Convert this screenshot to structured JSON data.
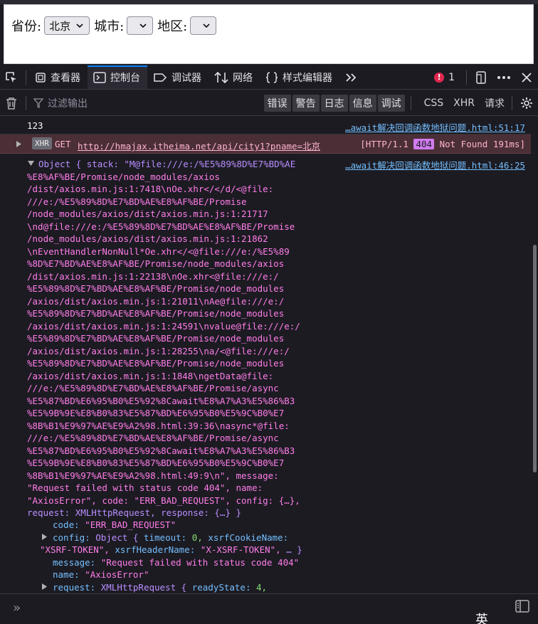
{
  "page": {
    "province_label": "省份:",
    "province_value": "北京",
    "city_label": "城市:",
    "city_value": "",
    "area_label": "地区:",
    "area_value": ""
  },
  "devtools": {
    "tabs": [
      {
        "label": "查看器",
        "icon": "inspector-icon"
      },
      {
        "label": "控制台",
        "icon": "console-icon",
        "active": true
      },
      {
        "label": "调试器",
        "icon": "debugger-icon"
      },
      {
        "label": "网络",
        "icon": "network-icon"
      },
      {
        "label": "样式编辑器",
        "icon": "style-editor-icon"
      }
    ],
    "error_count": "1",
    "filter_placeholder": "过滤输出",
    "levels": [
      "错误",
      "警告",
      "日志",
      "信息",
      "调试"
    ],
    "types": [
      "CSS",
      "XHR",
      "请求"
    ],
    "accent_color": "#0a84ff",
    "error_color": "#e22850"
  },
  "console": {
    "log1": {
      "text": "123",
      "source": "…await解决回调函数地狱问题.html:51:17"
    },
    "xhr": {
      "badge": "XHR",
      "method": "GET",
      "url": "http://hmajax.itheima.net/api/city1?pname=北京",
      "status_prefix": "[HTTP/1.1",
      "code": "404",
      "status_suffix": "Not Found 191ms]"
    },
    "object": {
      "source": "…await解决回调函数地狱问题.html:46:25",
      "lines": [
        "Object { stack: \"M@file:///e:/%E5%89%8D%E7%BD%AE",
        "%E8%AF%BE/Promise/node_modules/axios",
        "/dist/axios.min.js:1:7418\\nOe.xhr</</d/<@file:",
        "///e:/%E5%89%8D%E7%BD%AE%E8%AF%BE/Promise",
        "/node_modules/axios/dist/axios.min.js:1:21717",
        "\\nd@file:///e:/%E5%89%8D%E7%BD%AE%E8%AF%BE/Promise",
        "/node_modules/axios/dist/axios.min.js:1:21862",
        "\\nEventHandlerNonNull*Oe.xhr</<@file:///e:/%E5%89",
        "%8D%E7%BD%AE%E8%AF%BE/Promise/node_modules/axios",
        "/dist/axios.min.js:1:22138\\nOe.xhr<@file:///e:/",
        "%E5%89%8D%E7%BD%AE%E8%AF%BE/Promise/node_modules",
        "/axios/dist/axios.min.js:1:21011\\nAe@file:///e:/",
        "%E5%89%8D%E7%BD%AE%E8%AF%BE/Promise/node_modules",
        "/axios/dist/axios.min.js:1:24591\\nvalue@file:///e:/",
        "%E5%89%8D%E7%BD%AE%E8%AF%BE/Promise/node_modules",
        "/axios/dist/axios.min.js:1:28255\\na/<@file:///e:/",
        "%E5%89%8D%E7%BD%AE%E8%AF%BE/Promise/node_modules",
        "/axios/dist/axios.min.js:1:1848\\ngetData@file:",
        "///e:/%E5%89%8D%E7%BD%AE%E8%AF%BE/Promise/async",
        "%E5%87%BD%E6%95%B0%E5%92%8Cawait%E8%A7%A3%E5%86%B3",
        "%E5%9B%9E%E8%B0%83%E5%87%BD%E6%95%B0%E5%9C%B0%E7",
        "%8B%B1%E9%97%AE%E9%A2%98.html:39:36\\nasync*@file:",
        "///e:/%E5%89%8D%E7%BD%AE%E8%AF%BE/Promise/async",
        "%E5%87%BD%E6%95%B0%E5%92%8Cawait%E8%A7%A3%E5%86%B3",
        "%E5%9B%9E%E8%B0%83%E5%87%BD%E6%95%B0%E5%9C%B0%E7",
        "%8B%B1%E9%97%AE%E9%A2%98.html:49:9\\n\", message:",
        "\"Request failed with status code 404\", name:",
        "\"AxiosError\", code: \"ERR_BAD_REQUEST\", config: {…},",
        "request: XMLHttpRequest, response: {…} }"
      ],
      "props": {
        "code_key": "code:",
        "code_val": "\"ERR_BAD_REQUEST\"",
        "config_key": "config:",
        "config_type": "Object {",
        "config_k1": "timeout:",
        "config_v1": "0,",
        "config_k2": "xsrfCookieName:",
        "config_v2": "\"XSRF-TOKEN\",",
        "config_k3": "xsrfHeaderName:",
        "config_v3": "\"X-XSRF-TOKEN\",",
        "config_end": "… }",
        "message_key": "message:",
        "message_val": "\"Request failed with status code 404\"",
        "name_key": "name:",
        "name_val": "\"AxiosError\"",
        "request_key": "request:",
        "request_type": "XMLHttpRequest {",
        "request_k1": "readyState:",
        "request_v1": "4,"
      }
    }
  },
  "input": {
    "prompt": "»",
    "ime_indicator": "英"
  }
}
